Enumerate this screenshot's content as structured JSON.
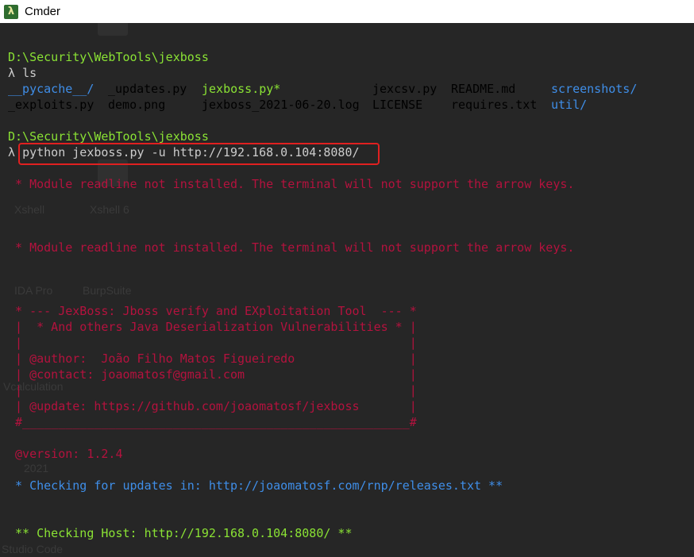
{
  "window": {
    "title": "Cmder",
    "app_icon": "lambda-icon"
  },
  "desktop_ghosts": [
    "Xshell",
    "Xshell 6",
    "IDA Pro",
    "BurpSuite",
    "Vcalculation",
    "2021",
    "Studio Code"
  ],
  "terminal": {
    "prompt_path_1": "D:\\Security\\WebTools\\jexboss",
    "prompt_symbol": "λ",
    "cmd_1": "ls",
    "ls_row1": [
      "__pycache__/",
      "_updates.py",
      "jexboss.py*",
      "jexcsv.py",
      "README.md",
      "screenshots/"
    ],
    "ls_row2": [
      "_exploits.py",
      "demo.png",
      "jexboss_2021-06-20.log",
      "LICENSE",
      "requires.txt",
      "util/"
    ],
    "prompt_path_2": "D:\\Security\\WebTools\\jexboss",
    "cmd_2": "python jexboss.py -u http://192.168.0.104:8080/",
    "warn_1": " * Module readline not installed. The terminal will not support the arrow keys.",
    "warn_2": " * Module readline not installed. The terminal will not support the arrow keys.",
    "banner": [
      " * --- JexBoss: Jboss verify and EXploitation Tool  --- *",
      " |  * And others Java Deserialization Vulnerabilities * |",
      " |                                                      |",
      " | @author:  João Filho Matos Figueiredo                |",
      " | @contact: joaomatosf@gmail.com                       |",
      " |                                                      |",
      " | @update: https://github.com/joaomatosf/jexboss       |",
      " #______________________________________________________#"
    ],
    "version": " @version: 1.2.4",
    "update_check": " * Checking for updates in: http://joaomatosf.com/rnp/releases.txt **",
    "host_check": " ** Checking Host: http://192.168.0.104:8080/ **"
  },
  "colors": {
    "path": "#8ae234",
    "directory": "#3f8ee8",
    "error": "#b4123e",
    "highlight_box": "#e02020"
  }
}
